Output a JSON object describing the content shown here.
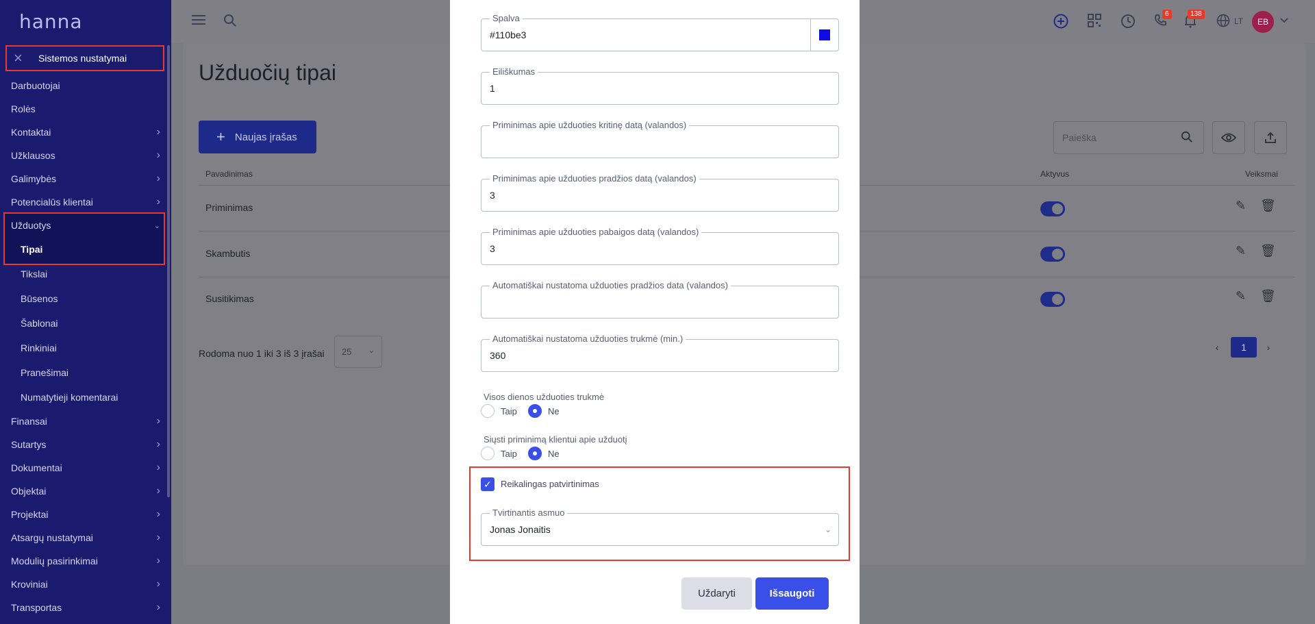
{
  "brand": "hanna",
  "sidebar": {
    "section_title": "Sistemos nustatymai",
    "items": [
      {
        "label": "Darbuotojai",
        "chevron": false
      },
      {
        "label": "Rolės",
        "chevron": false
      },
      {
        "label": "Kontaktai",
        "chevron": true
      },
      {
        "label": "Užklausos",
        "chevron": true
      },
      {
        "label": "Galimybės",
        "chevron": true
      },
      {
        "label": "Potencialūs klientai",
        "chevron": true
      },
      {
        "label": "Užduotys",
        "chevron": true,
        "expanded": true
      },
      {
        "label": "Tipai",
        "sub": true,
        "active": true
      },
      {
        "label": "Tikslai",
        "sub": true
      },
      {
        "label": "Būsenos",
        "sub": true
      },
      {
        "label": "Šablonai",
        "sub": true
      },
      {
        "label": "Rinkiniai",
        "sub": true
      },
      {
        "label": "Pranešimai",
        "sub": true
      },
      {
        "label": "Numatytieji komentarai",
        "sub": true
      },
      {
        "label": "Finansai",
        "chevron": true
      },
      {
        "label": "Sutartys",
        "chevron": true
      },
      {
        "label": "Dokumentai",
        "chevron": true
      },
      {
        "label": "Objektai",
        "chevron": true
      },
      {
        "label": "Projektai",
        "chevron": true
      },
      {
        "label": "Atsargų nustatymai",
        "chevron": true
      },
      {
        "label": "Modulių pasirinkimai",
        "chevron": true
      },
      {
        "label": "Kroviniai",
        "chevron": true
      },
      {
        "label": "Transportas",
        "chevron": true
      }
    ]
  },
  "topbar": {
    "badges": {
      "calls": "6",
      "notifications": "138"
    },
    "language": "LT",
    "avatar_initials": "EB"
  },
  "page": {
    "title": "Užduočių tipai",
    "new_button": "Naujas įrašas",
    "search_placeholder": "Paieška",
    "columns": {
      "name": "Pavadinimas",
      "active": "Aktyvus",
      "actions": "Veiksmai"
    },
    "rows": [
      {
        "name": "Priminimas"
      },
      {
        "name": "Skambutis"
      },
      {
        "name": "Susitikimas"
      }
    ],
    "pager_text": "Rodoma nuo 1 iki 3 iš 3 įrašai",
    "page_size": "25",
    "current_page": "1"
  },
  "modal": {
    "color_label": "Spalva",
    "color_value": "#110be3",
    "order_label": "Eiliškumas",
    "order_value": "1",
    "critical_label": "Priminimas apie užduoties kritinę datą (valandos)",
    "critical_value": "",
    "start_reminder_label": "Priminimas apie užduoties pradžios datą (valandos)",
    "start_reminder_value": "3",
    "end_reminder_label": "Priminimas apie užduoties pabaigos datą (valandos)",
    "end_reminder_value": "3",
    "auto_start_label": "Automatiškai nustatoma užduoties pradžios data (valandos)",
    "auto_start_value": "",
    "auto_duration_label": "Automatiškai nustatoma užduoties trukmė (min.)",
    "auto_duration_value": "360",
    "all_day_label": "Visos dienos užduoties trukmė",
    "send_reminder_label": "Siųsti priminimą klientui apie užduotį",
    "yes": "Taip",
    "no": "Ne",
    "all_day_selected": "Ne",
    "send_reminder_selected": "Ne",
    "approval_label": "Reikalingas patvirtinimas",
    "approval_checked": true,
    "approver_label": "Tvirtinantis asmuo",
    "approver_value": "Jonas Jonaitis",
    "close_button": "Uždaryti",
    "save_button": "Išsaugoti"
  }
}
